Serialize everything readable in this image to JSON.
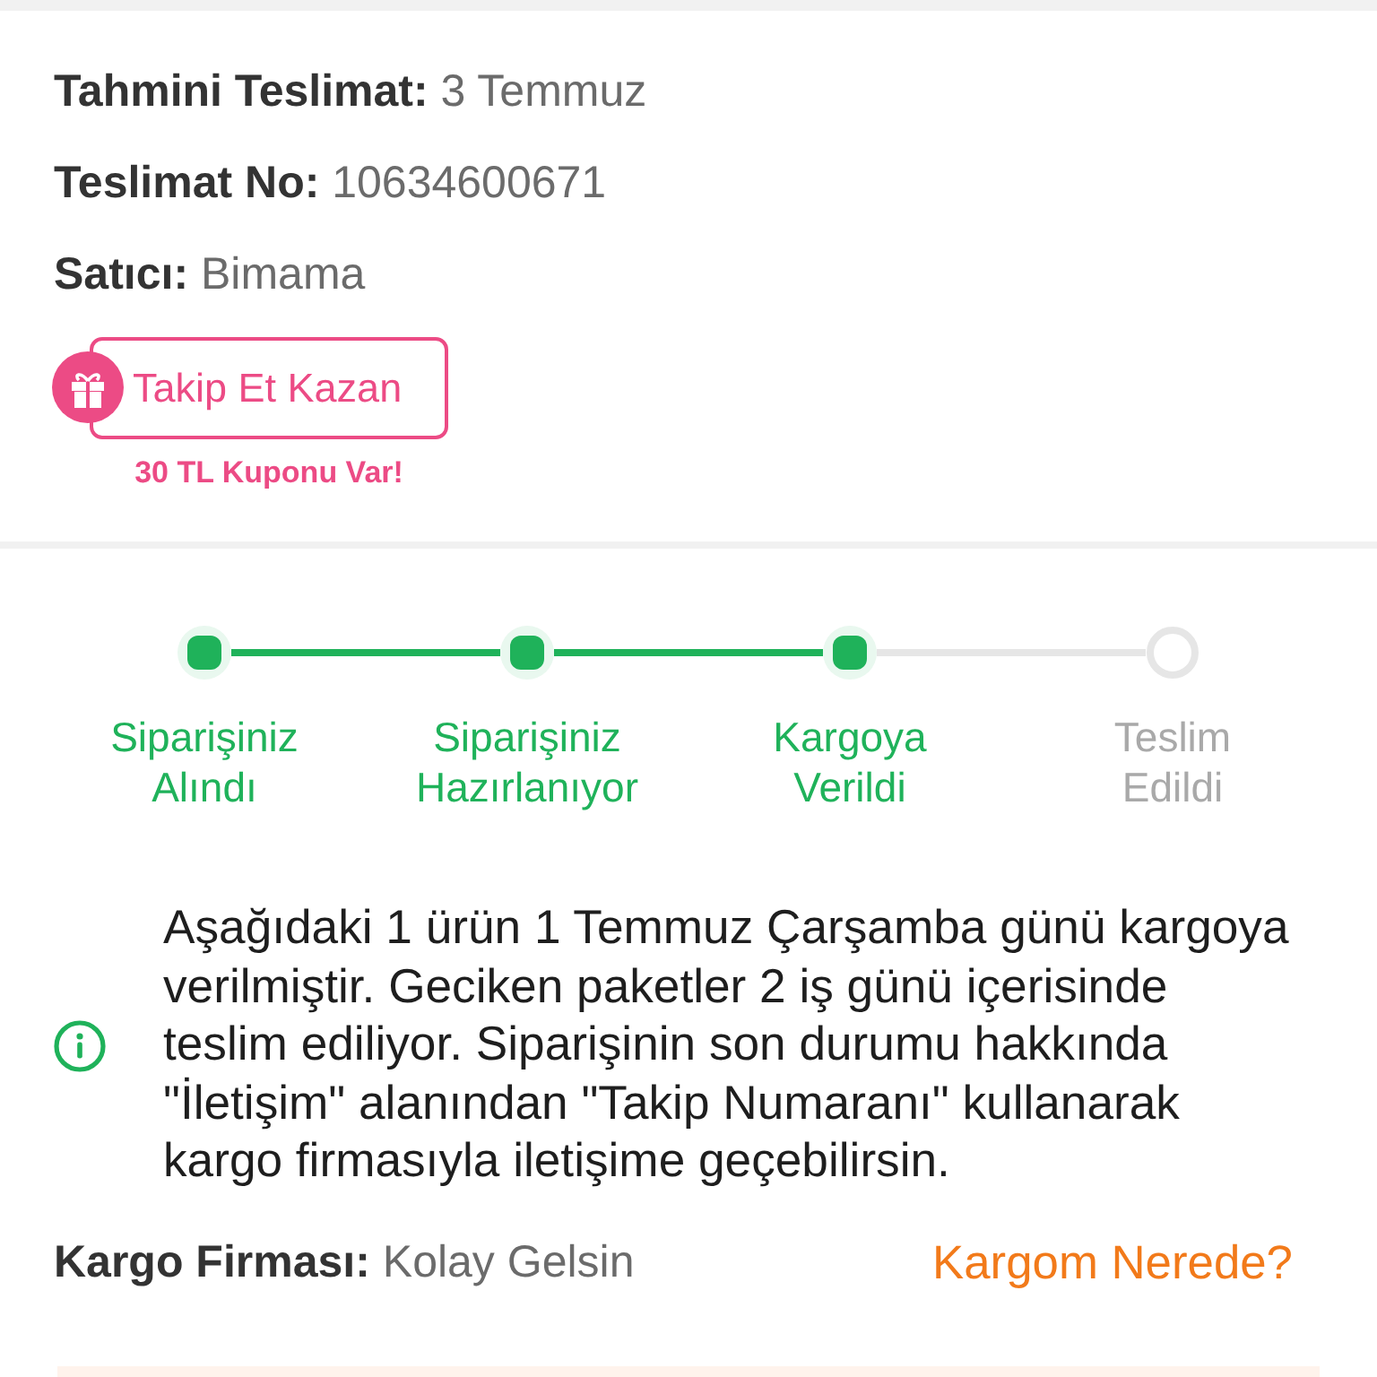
{
  "delivery": {
    "rows": [
      {
        "label": "Tahmini Teslimat:",
        "value": "3 Temmuz"
      },
      {
        "label": "Teslimat No:",
        "value": "10634600671"
      },
      {
        "label": "Satıcı:",
        "value": "Bimama"
      }
    ],
    "follow_button": {
      "label": "Takip Et Kazan",
      "coupon_note": "30 TL Kuponu Var!"
    }
  },
  "tracker": {
    "steps": [
      {
        "label": "Siparişiniz Alındı",
        "done": true
      },
      {
        "label": "Siparişiniz Hazırlanıyor",
        "done": true
      },
      {
        "label": "Kargoya Verildi",
        "done": true
      },
      {
        "label": "Teslim Edildi",
        "done": false
      }
    ]
  },
  "shipment_note": {
    "text": "Aşağıdaki 1 ürün 1 Temmuz Çarşamba günü kargoya verilmiştir. Geciken paketler 2 iş günü içerisinde teslim ediliyor. Siparişinin son durumu hakkında \"İletişim\" alanından \"Takip Numaranı\" kullanarak kargo firmasıyla iletişime geçebilirsin."
  },
  "carrier": {
    "label": "Kargo Firması:",
    "value": "Kolay Gelsin",
    "link": "Kargom Nerede?"
  }
}
